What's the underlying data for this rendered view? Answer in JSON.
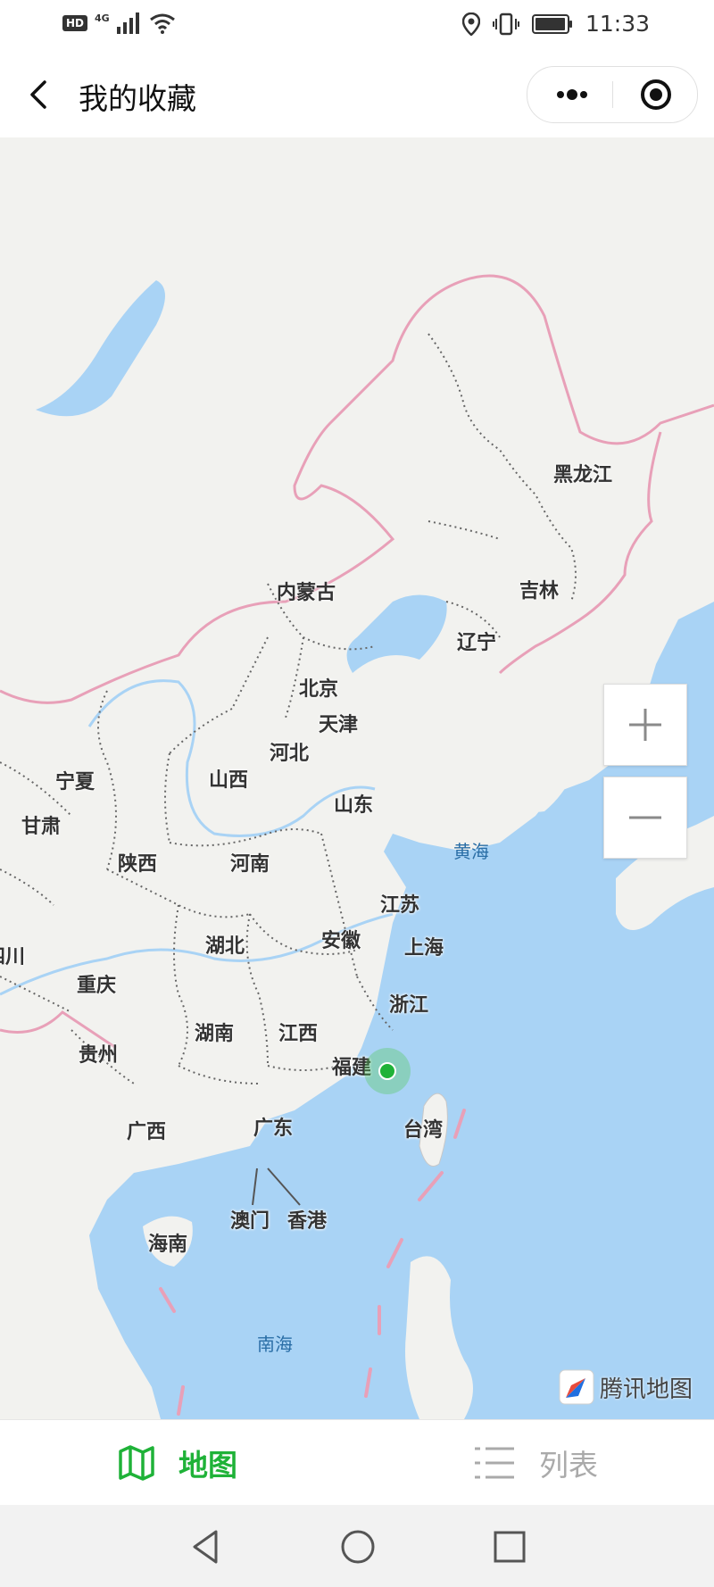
{
  "status_bar": {
    "hd": "HD",
    "network": "4G",
    "time": "11:33",
    "icons": [
      "signal-icon",
      "wifi-icon",
      "location-icon",
      "vibrate-icon",
      "battery-icon"
    ]
  },
  "nav": {
    "title": "我的收藏",
    "icons": [
      "back-arrow-icon",
      "more-dots-icon",
      "close-target-icon"
    ]
  },
  "map": {
    "regions": [
      "黑龙江",
      "吉林",
      "辽宁",
      "内蒙古",
      "北京",
      "天津",
      "河北",
      "山西",
      "宁夏",
      "甘肃",
      "山东",
      "陕西",
      "河南",
      "江苏",
      "上海",
      "安徽",
      "湖北",
      "四川",
      "重庆",
      "浙江",
      "湖南",
      "江西",
      "贵州",
      "福建",
      "台湾",
      "广西",
      "广东",
      "澳门",
      "香港",
      "海南"
    ],
    "seas": [
      "黄海",
      "南海"
    ],
    "brand": "腾讯地图",
    "marker_color": "#1fb238",
    "colors": {
      "water": "#a9d3f5",
      "land": "#f2f2ef",
      "border": "#e8a0b8"
    }
  },
  "tabs": {
    "map": "地图",
    "list": "列表",
    "active_color": "#1fb238",
    "inactive_color": "#aaaaaa"
  },
  "system_nav": [
    "back-triangle-icon",
    "home-circle-icon",
    "recents-square-icon"
  ]
}
